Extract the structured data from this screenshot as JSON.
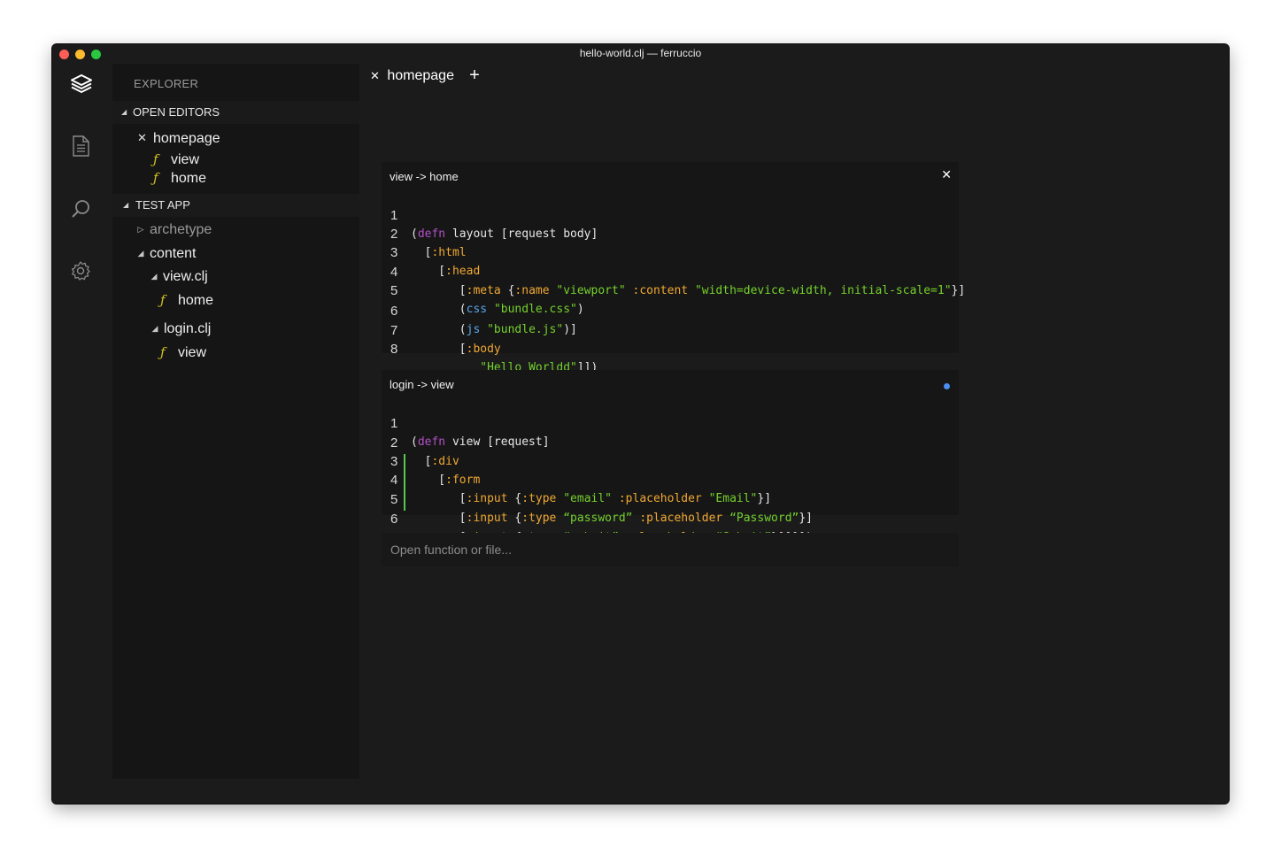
{
  "window": {
    "title": "hello-world.clj — ferruccio"
  },
  "activity": {
    "icons": [
      "layers-icon",
      "file-icon",
      "search-icon",
      "settings-icon"
    ]
  },
  "sidebar": {
    "title": "EXPLORER",
    "open_editors": {
      "label": "OPEN EDITORS",
      "items": [
        {
          "label": "homepage",
          "kind": "file"
        },
        {
          "label": "view",
          "kind": "function"
        },
        {
          "label": "home",
          "kind": "function"
        }
      ]
    },
    "project": {
      "label": "TEST APP",
      "items": [
        {
          "label": "archetype",
          "kind": "folder-collapsed"
        },
        {
          "label": "content",
          "kind": "folder-expanded"
        },
        {
          "label": "view.clj",
          "kind": "file-expanded"
        },
        {
          "label": "home",
          "kind": "function"
        },
        {
          "label": "login.clj",
          "kind": "file-expanded"
        },
        {
          "label": "view",
          "kind": "function"
        }
      ]
    }
  },
  "tabs": [
    {
      "label": "homepage",
      "active": true
    }
  ],
  "tab_add_label": "+",
  "panels": [
    {
      "title": "view -> home",
      "action": "close",
      "lines": [
        {
          "n": "1",
          "code": "(defn layout [request body]"
        },
        {
          "n": "2",
          "code": "  [:html"
        },
        {
          "n": "3",
          "code": "    [:head"
        },
        {
          "n": "4",
          "code": "       [:meta {:name \"viewport\" :content \"width=device-width, initial-scale=1\"}]"
        },
        {
          "n": "5",
          "code": "       (css \"bundle.css\")"
        },
        {
          "n": "6",
          "code": "       (js \"bundle.js\")]"
        },
        {
          "n": "7",
          "code": "       [:body"
        },
        {
          "n": "8",
          "code": "          \"Hello Worldd\"]])"
        }
      ]
    },
    {
      "title": "login -> view",
      "action": "modified",
      "lines": [
        {
          "n": "1",
          "code": "(defn view [request]"
        },
        {
          "n": "2",
          "code": "  [:div"
        },
        {
          "n": "3",
          "code": "    [:form"
        },
        {
          "n": "4",
          "code": "       [:input {:type \"email\" :placeholder \"Email\"}]"
        },
        {
          "n": "5",
          "code": "       [:input {:type “password” :placeholder “Password”}]"
        },
        {
          "n": "6",
          "code": "       [:input {:type “submit” :placeholder “Submit”}]]]])"
        }
      ],
      "changed_lines": [
        "4",
        "5",
        "6"
      ]
    }
  ],
  "search": {
    "placeholder": "Open function or file..."
  },
  "colors": {
    "keyword": "#b14fc5",
    "clojure_keyword": "#f0a832",
    "string": "#74d12c",
    "function_call": "#58a6e8",
    "modified_dot": "#4a8ff2",
    "git_added": "#56c94b"
  }
}
